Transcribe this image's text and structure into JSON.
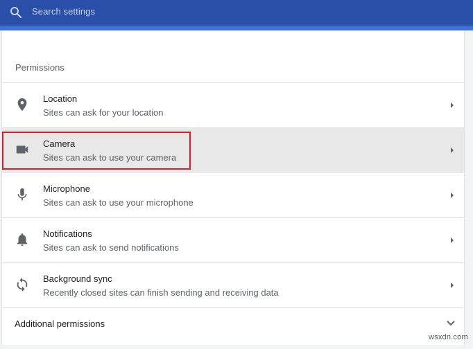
{
  "search": {
    "placeholder": "Search settings"
  },
  "section": {
    "title": "Permissions"
  },
  "permissions": [
    {
      "title": "Location",
      "subtitle": "Sites can ask for your location",
      "icon": "location-pin-icon"
    },
    {
      "title": "Camera",
      "subtitle": "Sites can ask to use your camera",
      "icon": "camera-icon"
    },
    {
      "title": "Microphone",
      "subtitle": "Sites can ask to use your microphone",
      "icon": "microphone-icon"
    },
    {
      "title": "Notifications",
      "subtitle": "Sites can ask to send notifications",
      "icon": "bell-icon"
    },
    {
      "title": "Background sync",
      "subtitle": "Recently closed sites can finish sending and receiving data",
      "icon": "sync-icon"
    }
  ],
  "additional": {
    "label": "Additional permissions"
  },
  "watermark": {
    "text": "wsxdn.com"
  },
  "colors": {
    "header": "#2a4fa8",
    "highlight_border": "#d32029",
    "selected_row": "#e8e8e8"
  }
}
